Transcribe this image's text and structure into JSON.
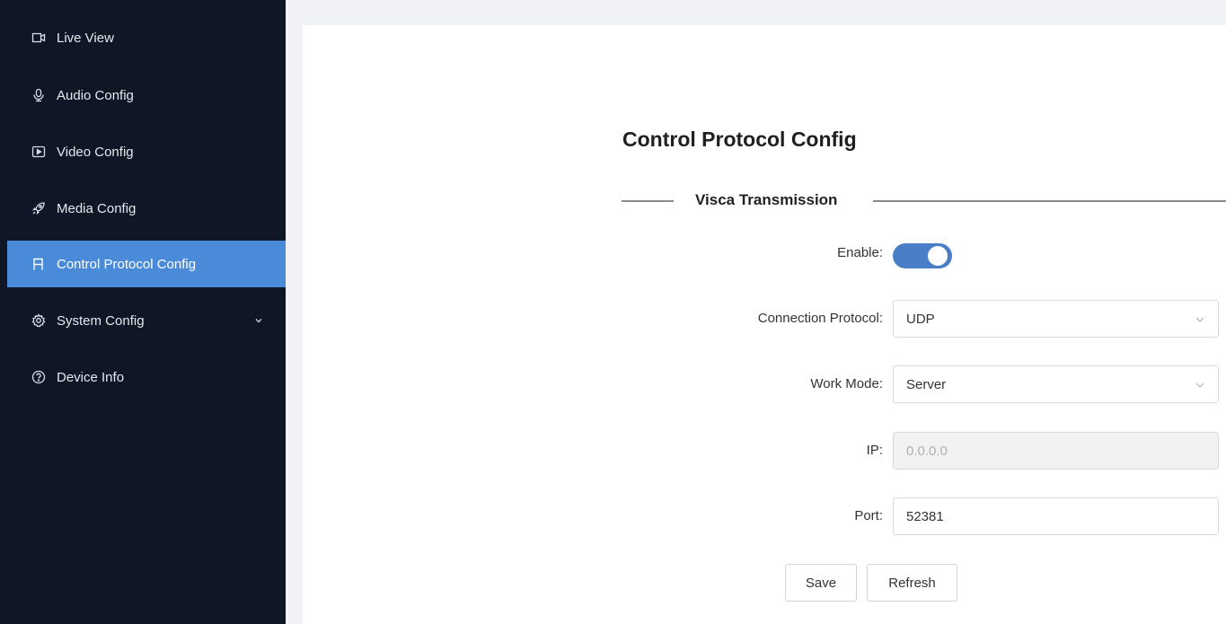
{
  "sidebar": {
    "items": [
      {
        "label": "Live View",
        "icon": "video-camera-icon"
      },
      {
        "label": "Audio Config",
        "icon": "microphone-icon"
      },
      {
        "label": "Video Config",
        "icon": "play-screen-icon"
      },
      {
        "label": "Media Config",
        "icon": "rocket-icon"
      },
      {
        "label": "Control Protocol Config",
        "icon": "control-icon",
        "active": true
      },
      {
        "label": "System Config",
        "icon": "gear-icon",
        "expandable": true
      },
      {
        "label": "Device Info",
        "icon": "question-circle-icon"
      }
    ]
  },
  "main": {
    "title": "Control Protocol Config",
    "section_title": "Visca Transmission",
    "form": {
      "enable_label": "Enable:",
      "enable_value": true,
      "protocol_label": "Connection Protocol:",
      "protocol_value": "UDP",
      "mode_label": "Work Mode:",
      "mode_value": "Server",
      "ip_label": "IP:",
      "ip_placeholder": "0.0.0.0",
      "port_label": "Port:",
      "port_value": "52381"
    },
    "buttons": {
      "save": "Save",
      "refresh": "Refresh"
    }
  },
  "colors": {
    "sidebar_bg": "#0f1626",
    "active_bg": "#4a8bd9",
    "toggle_on": "#4a7fc8"
  }
}
